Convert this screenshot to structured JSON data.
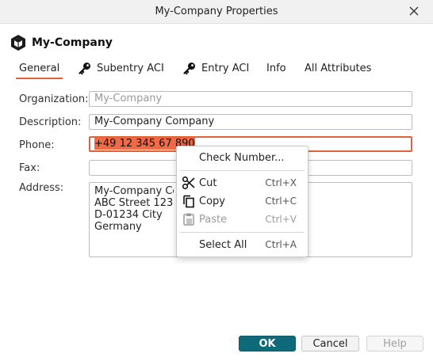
{
  "window": {
    "title": "My-Company Properties"
  },
  "entry": {
    "name": "My-Company"
  },
  "tabs": [
    {
      "label": "General"
    },
    {
      "label": "Subentry ACI"
    },
    {
      "label": "Entry ACI"
    },
    {
      "label": "Info"
    },
    {
      "label": "All Attributes"
    }
  ],
  "form": {
    "organization": {
      "label": "Organization:",
      "value": "My-Company"
    },
    "description": {
      "label": "Description:",
      "value": "My-Company Company"
    },
    "phone": {
      "label": "Phone:",
      "value": "+49 12 345 67 890"
    },
    "fax": {
      "label": "Fax:",
      "value": ""
    },
    "address": {
      "label": "Address:",
      "lines": [
        "My-Company Company",
        "ABC Street 123",
        "D-01234 City",
        "Germany"
      ]
    }
  },
  "context_menu": {
    "check_number": "Check Number...",
    "cut": {
      "label": "Cut",
      "shortcut": "Ctrl+X",
      "icon": "scissors-icon"
    },
    "copy": {
      "label": "Copy",
      "shortcut": "Ctrl+C",
      "icon": "copy-icon"
    },
    "paste": {
      "label": "Paste",
      "shortcut": "Ctrl+V",
      "icon": "clipboard-icon",
      "disabled": true
    },
    "select_all": {
      "label": "Select All",
      "shortcut": "Ctrl+A"
    }
  },
  "buttons": {
    "ok": "OK",
    "cancel": "Cancel",
    "help": "Help"
  },
  "colors": {
    "accent": "#e0623a",
    "primary_button": "#0e6a7a",
    "selection": "#ef6a45"
  }
}
